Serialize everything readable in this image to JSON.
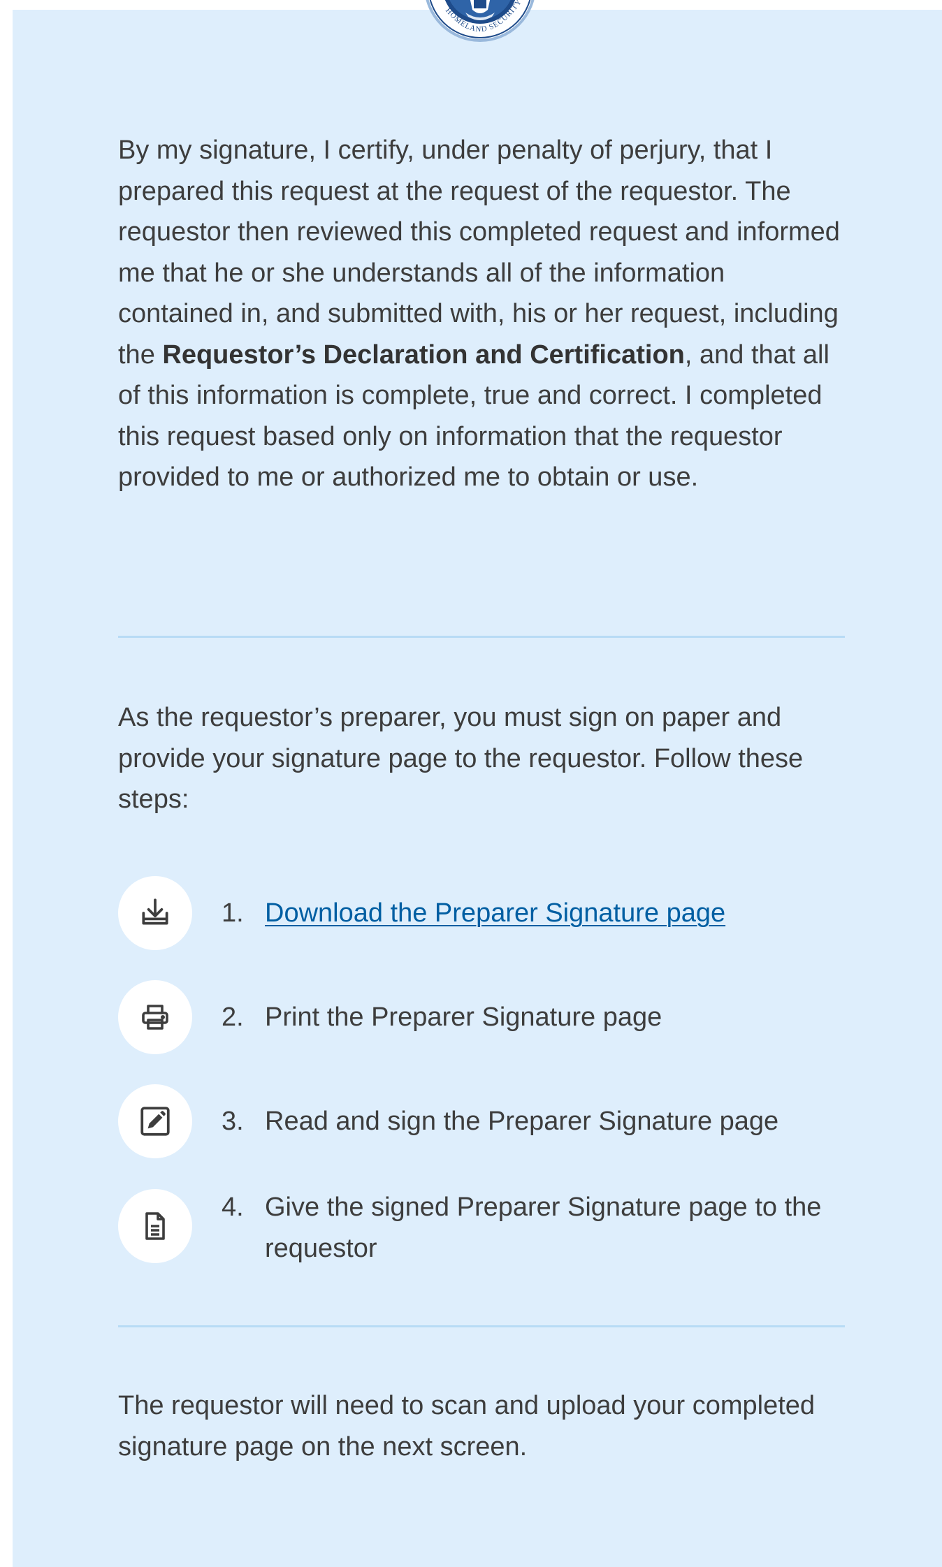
{
  "header": {
    "seal_text": "HOMELAND SECURITY"
  },
  "certification": {
    "text_before": "By my signature, I certify, under penalty of perjury, that I prepared this request at the request of the requestor. The requestor then reviewed this completed request and informed me that he or she understands all of the information contained in, and submitted with, his or her request, including the ",
    "bold_text": "Requestor’s Declaration and Certification",
    "text_after": ", and that all of this information is complete, true and correct. I completed this request based only on information that the requestor provided to me or authorized me to obtain or use."
  },
  "instructions": {
    "intro": "As the requestor’s preparer, you must sign on paper and provide your signature page to the requestor. Follow these steps:",
    "steps": [
      {
        "number": "1.",
        "text": "Download the Preparer Signature page",
        "icon": "download-icon",
        "is_link": true
      },
      {
        "number": "2.",
        "text": "Print the Preparer Signature page",
        "icon": "printer-icon",
        "is_link": false
      },
      {
        "number": "3.",
        "text": "Read and sign the Preparer Signature page",
        "icon": "edit-icon",
        "is_link": false
      },
      {
        "number": "4.",
        "text": "Give the signed Preparer Signature page to the requestor",
        "icon": "document-icon",
        "is_link": false
      }
    ]
  },
  "footer_note": "The requestor will need to scan and upload your completed signature page on the next screen.",
  "colors": {
    "panel_background": "#deeefc",
    "link": "#005ea2",
    "divider": "#b8dbf5",
    "seal_blue": "#1e4b8a"
  }
}
